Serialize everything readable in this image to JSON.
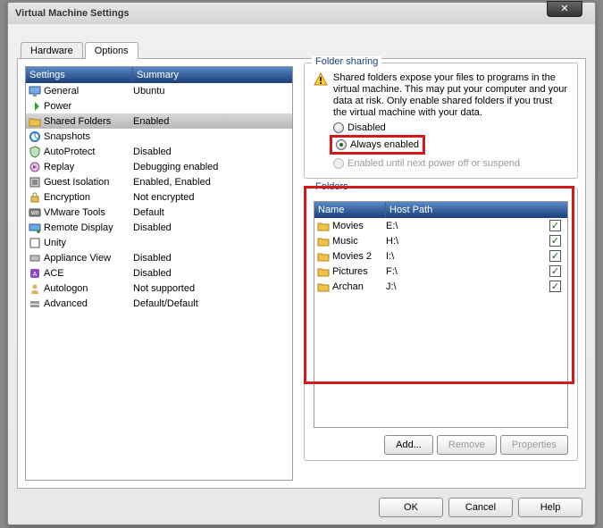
{
  "dialog": {
    "title": "Virtual Machine Settings"
  },
  "tabs": {
    "hardware": "Hardware",
    "options": "Options"
  },
  "settings_list": {
    "header": {
      "col1": "Settings",
      "col2": "Summary"
    },
    "rows": [
      {
        "icon": "monitor",
        "name": "General",
        "summary": "Ubuntu",
        "selected": false
      },
      {
        "icon": "power",
        "name": "Power",
        "summary": "",
        "selected": false
      },
      {
        "icon": "folder",
        "name": "Shared Folders",
        "summary": "Enabled",
        "selected": true
      },
      {
        "icon": "snapshot",
        "name": "Snapshots",
        "summary": "",
        "selected": false
      },
      {
        "icon": "shield",
        "name": "AutoProtect",
        "summary": "Disabled",
        "selected": false
      },
      {
        "icon": "replay",
        "name": "Replay",
        "summary": "Debugging enabled",
        "selected": false
      },
      {
        "icon": "guest",
        "name": "Guest Isolation",
        "summary": "Enabled, Enabled",
        "selected": false
      },
      {
        "icon": "lock",
        "name": "Encryption",
        "summary": "Not encrypted",
        "selected": false
      },
      {
        "icon": "tools",
        "name": "VMware Tools",
        "summary": "Default",
        "selected": false
      },
      {
        "icon": "remote",
        "name": "Remote Display",
        "summary": "Disabled",
        "selected": false
      },
      {
        "icon": "unity",
        "name": "Unity",
        "summary": "",
        "selected": false
      },
      {
        "icon": "appliance",
        "name": "Appliance View",
        "summary": "Disabled",
        "selected": false
      },
      {
        "icon": "ace",
        "name": "ACE",
        "summary": "Disabled",
        "selected": false
      },
      {
        "icon": "autologon",
        "name": "Autologon",
        "summary": "Not supported",
        "selected": false
      },
      {
        "icon": "advanced",
        "name": "Advanced",
        "summary": "Default/Default",
        "selected": false
      }
    ]
  },
  "folder_sharing": {
    "legend": "Folder sharing",
    "warning": "Shared folders expose your files to programs in the virtual machine. This may put your computer and your data at risk. Only enable shared folders if you trust the virtual machine with your data.",
    "opts": {
      "disabled": "Disabled",
      "always": "Always enabled",
      "until": "Enabled until next power off or suspend"
    }
  },
  "folders": {
    "legend": "Folders",
    "header": {
      "name": "Name",
      "path": "Host Path"
    },
    "rows": [
      {
        "name": "Movies",
        "path": "E:\\",
        "checked": true
      },
      {
        "name": "Music",
        "path": "H:\\",
        "checked": true
      },
      {
        "name": "Movies 2",
        "path": "I:\\",
        "checked": true
      },
      {
        "name": "Pictures",
        "path": "F:\\",
        "checked": true
      },
      {
        "name": "Archan",
        "path": "J:\\",
        "checked": true
      }
    ],
    "buttons": {
      "add": "Add...",
      "remove": "Remove",
      "props": "Properties"
    }
  },
  "bottom": {
    "ok": "OK",
    "cancel": "Cancel",
    "help": "Help"
  }
}
